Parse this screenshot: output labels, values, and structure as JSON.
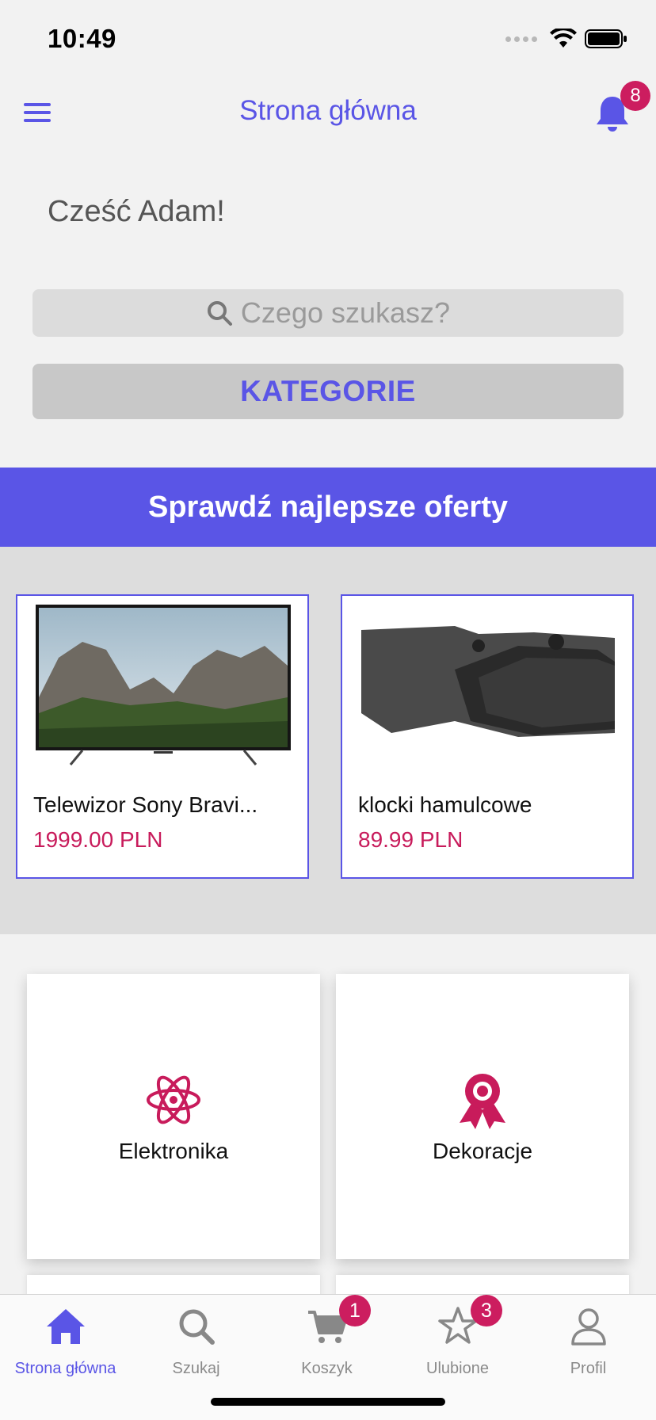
{
  "status": {
    "time": "10:49"
  },
  "header": {
    "title": "Strona główna",
    "notification_count": "8"
  },
  "greeting": "Cześć Adam!",
  "search": {
    "placeholder": "Czego szukasz?"
  },
  "categories_button": "KATEGORIE",
  "offers": {
    "banner": "Sprawdź najlepsze oferty",
    "items": [
      {
        "name": "Telewizor Sony Bravi...",
        "price": "1999.00 PLN"
      },
      {
        "name": "klocki hamulcowe",
        "price": "89.99 PLN"
      }
    ]
  },
  "categories": [
    {
      "label": "Elektronika",
      "icon": "atom-icon"
    },
    {
      "label": "Dekoracje",
      "icon": "award-icon"
    }
  ],
  "tabs": [
    {
      "label": "Strona główna",
      "icon": "home-icon",
      "active": true
    },
    {
      "label": "Szukaj",
      "icon": "search-icon"
    },
    {
      "label": "Koszyk",
      "icon": "cart-icon",
      "badge": "1"
    },
    {
      "label": "Ulubione",
      "icon": "star-icon",
      "badge": "3"
    },
    {
      "label": "Profil",
      "icon": "user-icon"
    }
  ],
  "colors": {
    "accent": "#5a55e6",
    "price": "#c81b5b",
    "badge": "#cc1d5f"
  }
}
